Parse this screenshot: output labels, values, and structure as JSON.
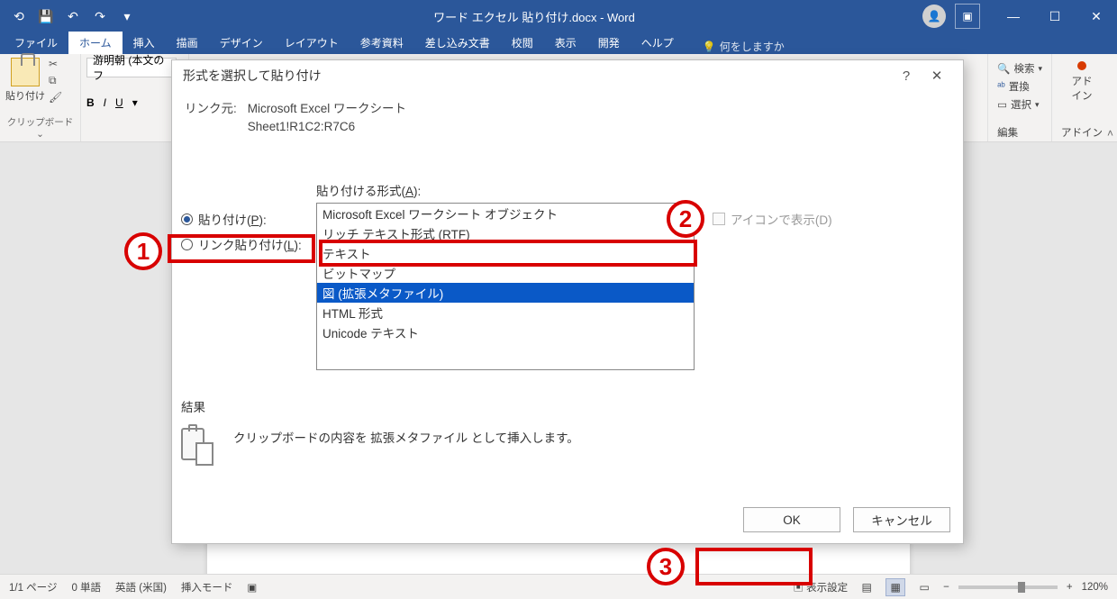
{
  "app": {
    "title": "ワード エクセル 貼り付け.docx  -  Word"
  },
  "tabs": {
    "file": "ファイル",
    "home": "ホーム",
    "insert": "挿入",
    "draw": "描画",
    "design": "デザイン",
    "layout": "レイアウト",
    "references": "参考資料",
    "mailings": "差し込み文書",
    "review": "校閲",
    "view": "表示",
    "developer": "開発",
    "help": "ヘルプ",
    "tellme": "何をしますか"
  },
  "ribbon": {
    "paste": "貼り付け",
    "clipboard_label": "クリップボード",
    "font_name": "游明朝 (本文のフ",
    "editing": {
      "find": "検索",
      "replace": "置換",
      "select": "選択",
      "label": "編集"
    },
    "addin": {
      "line1": "アド",
      "line2": "イン",
      "label": "アドイン"
    }
  },
  "dialog": {
    "title": "形式を選択して貼り付け",
    "help": "?",
    "close": "✕",
    "link_label": "リンク元:",
    "link_src1": "Microsoft Excel ワークシート",
    "link_src2": "Sheet1!R1C2:R7C6",
    "radio_paste": "貼り付け(P):",
    "radio_link": "リンク貼り付け(L):",
    "format_header": "貼り付ける形式(A):",
    "formats": [
      "Microsoft Excel ワークシート オブジェクト",
      "リッチ テキスト形式 (RTF)",
      "テキスト",
      "ビットマップ",
      "図 (拡張メタファイル)",
      "HTML 形式",
      "Unicode テキスト"
    ],
    "icon_display": "アイコンで表示(D)",
    "result_label": "結果",
    "result_text": "クリップボードの内容を 拡張メタファイル として挿入します。",
    "ok": "OK",
    "cancel": "キャンセル"
  },
  "status": {
    "page": "1/1 ページ",
    "words": "0 単語",
    "lang": "英語 (米国)",
    "insert_mode": "挿入モード",
    "display_settings": "表示設定",
    "zoom": "120%"
  },
  "callouts": {
    "n1": "1",
    "n2": "2",
    "n3": "3"
  }
}
